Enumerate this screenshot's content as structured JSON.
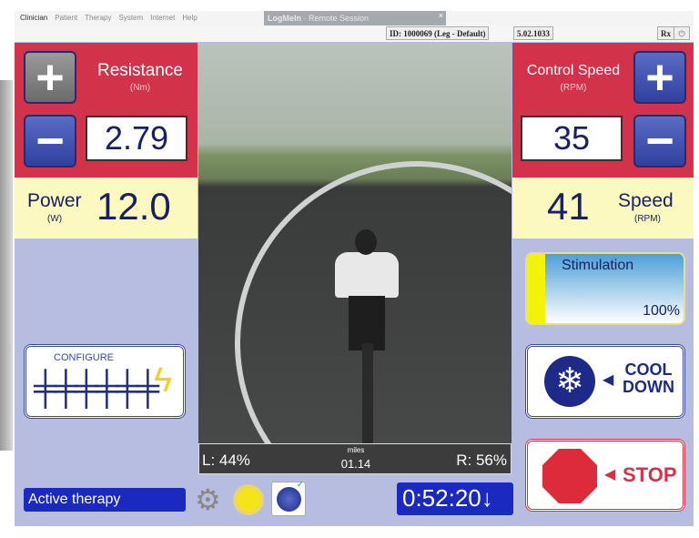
{
  "menu": [
    "Clinician",
    "Patient",
    "Therapy",
    "System",
    "Internet",
    "Help"
  ],
  "remote_session": {
    "brand": "LogMeIn",
    "title": " · Remote Session",
    "close": "×"
  },
  "idbar": {
    "id": "ID: 1000069 (Leg - Default)",
    "version": "5.02.1033",
    "rx": "Rx",
    "power_icon": "power-icon"
  },
  "resistance": {
    "title": "Resistance",
    "unit": "(Nm)",
    "value": "2.79",
    "plus": "+",
    "minus": "−"
  },
  "power": {
    "title": "Power",
    "unit": "(W)",
    "value": "12.0"
  },
  "control_speed": {
    "title": "Control Speed",
    "unit": "(RPM)",
    "value": "35",
    "plus": "+",
    "minus": "−"
  },
  "speed": {
    "title": "Speed",
    "unit": "(RPM)",
    "value": "41"
  },
  "stimulation": {
    "title": "Stimulation",
    "value": "100%",
    "level_percent": 100
  },
  "configure": {
    "label": "CONFIGURE"
  },
  "cool_down": {
    "line1": "COOL",
    "line2": "DOWN"
  },
  "stop": {
    "label": "STOP"
  },
  "stats": {
    "left": "L: 44%",
    "unit": "miles",
    "distance": "01.14",
    "right": "R: 56%"
  },
  "status": {
    "text": "Active therapy"
  },
  "timer": {
    "value": "0:52:20↓"
  },
  "colors": {
    "red": "#d2334a",
    "blue": "#1a2ac0",
    "panel": "#b7bde0",
    "yellow": "#fbf8c0"
  }
}
